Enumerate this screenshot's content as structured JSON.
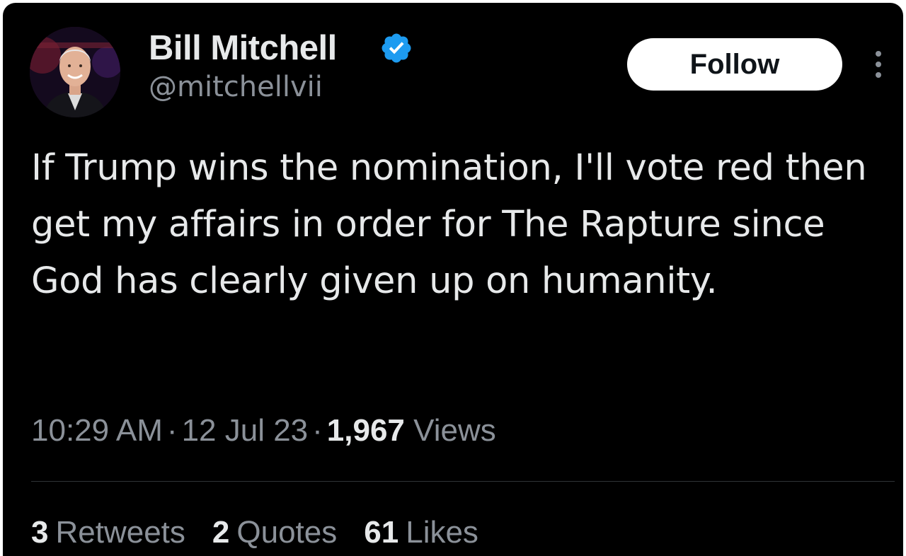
{
  "user": {
    "display_name": "Bill Mitchell",
    "handle": "@mitchellvii",
    "verified": true
  },
  "actions": {
    "follow_label": "Follow",
    "more_icon": "more-vertical-icon"
  },
  "tweet": {
    "text": "If Trump wins the nomination, I'll vote red then get my affairs in order for The Rapture since God has clearly given up on humanity."
  },
  "meta": {
    "time": "10:29 AM",
    "date": "12 Jul 23",
    "separator": "·",
    "views_count": "1,967",
    "views_label": "Views"
  },
  "stats": {
    "retweets_count": "3",
    "retweets_label": "Retweets",
    "quotes_count": "2",
    "quotes_label": "Quotes",
    "likes_count": "61",
    "likes_label": "Likes"
  },
  "colors": {
    "background": "#000000",
    "text_primary": "#e7e9ea",
    "text_secondary": "#8b9199",
    "verified_blue": "#1d9bf0",
    "follow_bg": "#ffffff"
  }
}
